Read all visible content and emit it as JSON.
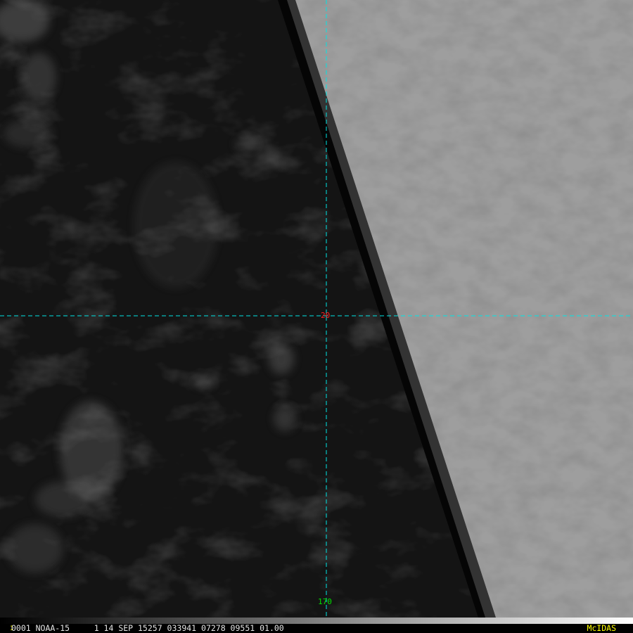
{
  "image": {
    "scene": "satellite-imagery",
    "content": "ocean-with-scattered-clouds-and-bright-swath",
    "colors": {
      "ocean": "#151515",
      "swath": "#9a9a9a",
      "grid_line": "#00e5e5",
      "lat_label": "#ff2020",
      "lon_label": "#00e000",
      "status_text": "#e6e6e6",
      "accent": "#ffff00"
    }
  },
  "grid": {
    "latitude_label": "20",
    "longitude_label": "170"
  },
  "status_bar": {
    "frame_marker": "1",
    "text": "0001 NOAA-15     1 14 SEP 15257 033941 07278 09551 01.00",
    "brand": "McIDAS"
  }
}
